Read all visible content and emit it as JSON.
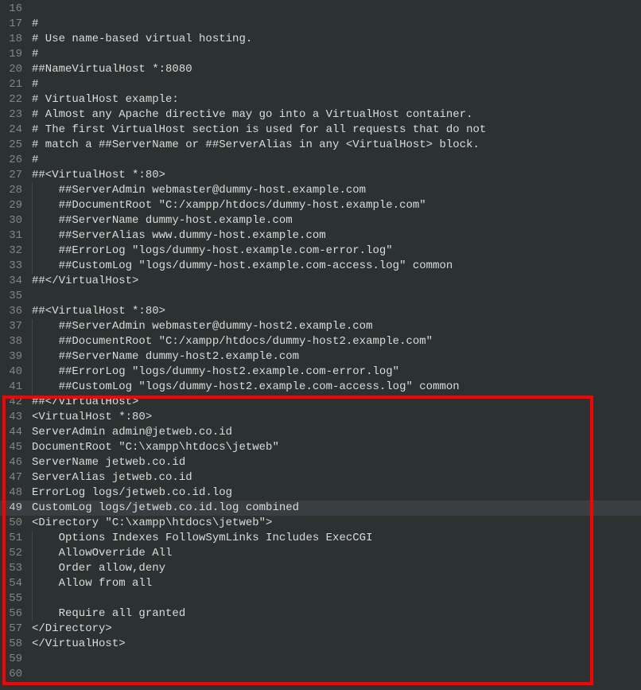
{
  "startLine": 16,
  "currentLine": 49,
  "highlight": {
    "startLine": 42,
    "endLine": 60
  },
  "lines": [
    {
      "n": 16,
      "indent": 0,
      "guides": 0,
      "text": ""
    },
    {
      "n": 17,
      "indent": 0,
      "guides": 0,
      "text": "#"
    },
    {
      "n": 18,
      "indent": 0,
      "guides": 0,
      "text": "# Use name-based virtual hosting."
    },
    {
      "n": 19,
      "indent": 0,
      "guides": 0,
      "text": "#"
    },
    {
      "n": 20,
      "indent": 0,
      "guides": 0,
      "text": "##NameVirtualHost *:8080"
    },
    {
      "n": 21,
      "indent": 0,
      "guides": 0,
      "text": "#"
    },
    {
      "n": 22,
      "indent": 0,
      "guides": 0,
      "text": "# VirtualHost example:"
    },
    {
      "n": 23,
      "indent": 0,
      "guides": 0,
      "text": "# Almost any Apache directive may go into a VirtualHost container."
    },
    {
      "n": 24,
      "indent": 0,
      "guides": 0,
      "text": "# The first VirtualHost section is used for all requests that do not"
    },
    {
      "n": 25,
      "indent": 0,
      "guides": 0,
      "text": "# match a ##ServerName or ##ServerAlias in any <VirtualHost> block."
    },
    {
      "n": 26,
      "indent": 0,
      "guides": 0,
      "text": "#"
    },
    {
      "n": 27,
      "indent": 0,
      "guides": 0,
      "text": "##<VirtualHost *:80>"
    },
    {
      "n": 28,
      "indent": 1,
      "guides": 1,
      "text": "##ServerAdmin webmaster@dummy-host.example.com"
    },
    {
      "n": 29,
      "indent": 1,
      "guides": 1,
      "text": "##DocumentRoot \"C:/xampp/htdocs/dummy-host.example.com\""
    },
    {
      "n": 30,
      "indent": 1,
      "guides": 1,
      "text": "##ServerName dummy-host.example.com"
    },
    {
      "n": 31,
      "indent": 1,
      "guides": 1,
      "text": "##ServerAlias www.dummy-host.example.com"
    },
    {
      "n": 32,
      "indent": 1,
      "guides": 1,
      "text": "##ErrorLog \"logs/dummy-host.example.com-error.log\""
    },
    {
      "n": 33,
      "indent": 1,
      "guides": 1,
      "text": "##CustomLog \"logs/dummy-host.example.com-access.log\" common"
    },
    {
      "n": 34,
      "indent": 0,
      "guides": 0,
      "text": "##</VirtualHost>"
    },
    {
      "n": 35,
      "indent": 0,
      "guides": 0,
      "text": ""
    },
    {
      "n": 36,
      "indent": 0,
      "guides": 0,
      "text": "##<VirtualHost *:80>"
    },
    {
      "n": 37,
      "indent": 1,
      "guides": 1,
      "text": "##ServerAdmin webmaster@dummy-host2.example.com"
    },
    {
      "n": 38,
      "indent": 1,
      "guides": 1,
      "text": "##DocumentRoot \"C:/xampp/htdocs/dummy-host2.example.com\""
    },
    {
      "n": 39,
      "indent": 1,
      "guides": 1,
      "text": "##ServerName dummy-host2.example.com"
    },
    {
      "n": 40,
      "indent": 1,
      "guides": 1,
      "text": "##ErrorLog \"logs/dummy-host2.example.com-error.log\""
    },
    {
      "n": 41,
      "indent": 1,
      "guides": 1,
      "text": "##CustomLog \"logs/dummy-host2.example.com-access.log\" common"
    },
    {
      "n": 42,
      "indent": 0,
      "guides": 0,
      "text": "##</VirtualHost>"
    },
    {
      "n": 43,
      "indent": 0,
      "guides": 0,
      "text": "<VirtualHost *:80>"
    },
    {
      "n": 44,
      "indent": 0,
      "guides": 0,
      "text": "ServerAdmin admin@jetweb.co.id"
    },
    {
      "n": 45,
      "indent": 0,
      "guides": 0,
      "text": "DocumentRoot \"C:\\xampp\\htdocs\\jetweb\""
    },
    {
      "n": 46,
      "indent": 0,
      "guides": 0,
      "text": "ServerName jetweb.co.id"
    },
    {
      "n": 47,
      "indent": 0,
      "guides": 0,
      "text": "ServerAlias jetweb.co.id"
    },
    {
      "n": 48,
      "indent": 0,
      "guides": 0,
      "text": "ErrorLog logs/jetweb.co.id.log"
    },
    {
      "n": 49,
      "indent": 0,
      "guides": 0,
      "text": "CustomLog logs/jetweb.co.id.log combined"
    },
    {
      "n": 50,
      "indent": 0,
      "guides": 0,
      "text": "<Directory \"C:\\xampp\\htdocs\\jetweb\">"
    },
    {
      "n": 51,
      "indent": 1,
      "guides": 1,
      "text": "Options Indexes FollowSymLinks Includes ExecCGI"
    },
    {
      "n": 52,
      "indent": 1,
      "guides": 1,
      "text": "AllowOverride All"
    },
    {
      "n": 53,
      "indent": 1,
      "guides": 1,
      "text": "Order allow,deny"
    },
    {
      "n": 54,
      "indent": 1,
      "guides": 1,
      "text": "Allow from all"
    },
    {
      "n": 55,
      "indent": 0,
      "guides": 1,
      "text": ""
    },
    {
      "n": 56,
      "indent": 1,
      "guides": 1,
      "text": "Require all granted"
    },
    {
      "n": 57,
      "indent": 0,
      "guides": 0,
      "text": "</Directory>"
    },
    {
      "n": 58,
      "indent": 0,
      "guides": 0,
      "text": "</VirtualHost>"
    },
    {
      "n": 59,
      "indent": 0,
      "guides": 0,
      "text": ""
    },
    {
      "n": 60,
      "indent": 0,
      "guides": 0,
      "text": ""
    }
  ]
}
